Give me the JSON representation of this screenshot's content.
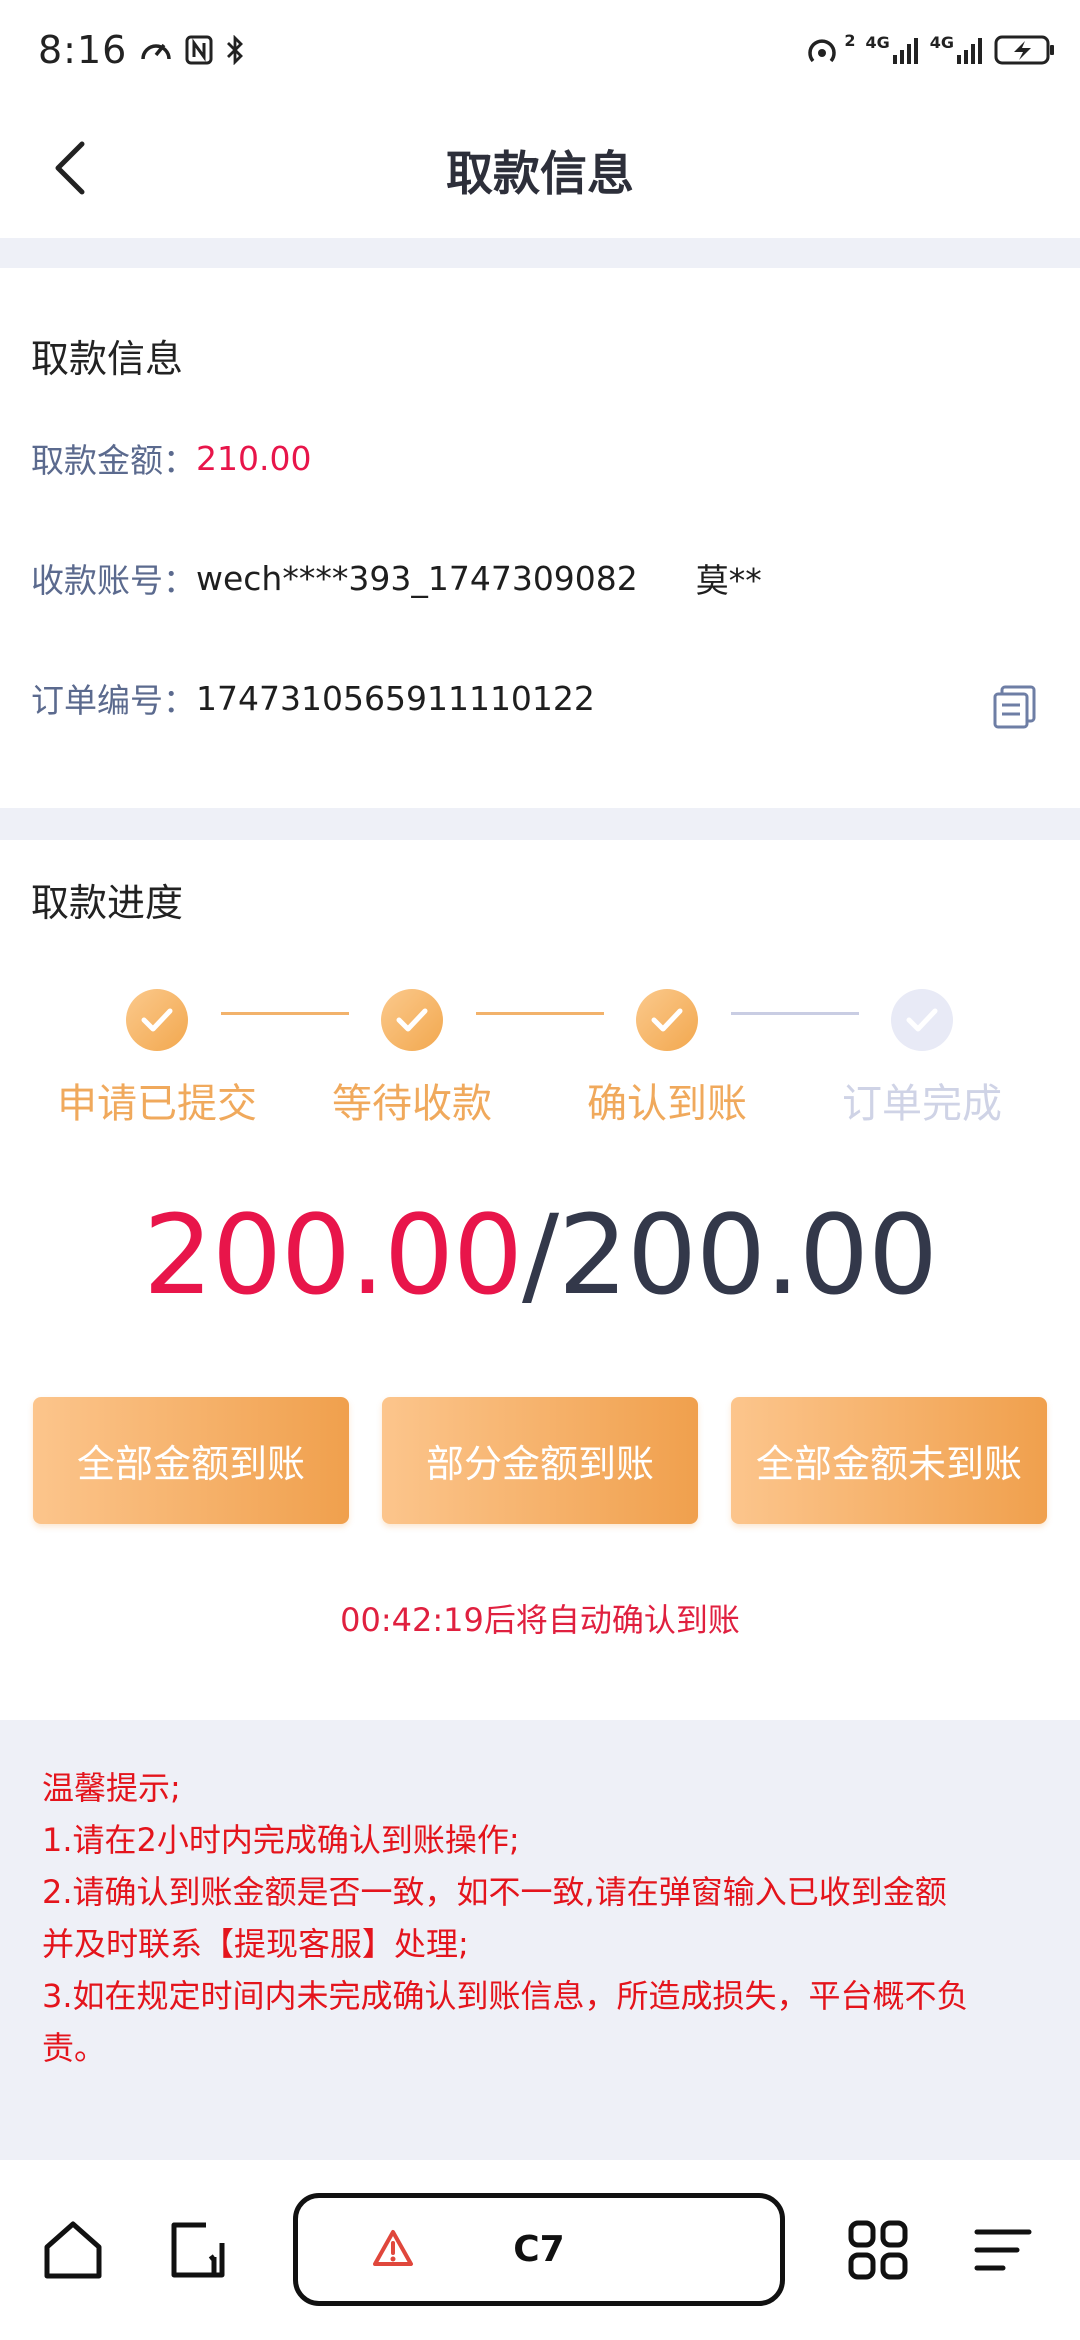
{
  "status_bar": {
    "time": "8:16",
    "sim_tag_1": "2",
    "net_1": "4G",
    "net_2": "4G"
  },
  "header": {
    "title": "取款信息"
  },
  "withdraw_info": {
    "section_title": "取款信息",
    "amount_label": "取款金额：",
    "amount_value": "210.00",
    "account_label": "收款账号：",
    "account_value": "wech****393_1747309082",
    "payee_name": "莫**",
    "order_label": "订单编号：",
    "order_value": "1747310565911110122"
  },
  "progress": {
    "section_title": "取款进度",
    "steps": [
      {
        "label": "申请已提交",
        "done": true
      },
      {
        "label": "等待收款",
        "done": true
      },
      {
        "label": "确认到账",
        "done": true
      },
      {
        "label": "订单完成",
        "done": false
      }
    ],
    "received": "200.00",
    "separator": "/",
    "total": "200.00",
    "buttons": {
      "all_received": "全部金额到账",
      "partial_received": "部分金额到账",
      "none_received": "全部金额未到账"
    },
    "countdown": "00:42:19后将自动确认到账"
  },
  "notice": {
    "title": "温馨提示;",
    "line1": "1.请在2小时内完成确认到账操作;",
    "line2a": "2.请确认到账金额是否一致，如不一致,请在弹窗输入已收到金额",
    "line2b": "并及时联系【提现客服】处理;",
    "line3a": "3.如在规定时间内未完成确认到账信息，所造成损失，平台概不负",
    "line3b": "责。"
  },
  "browser_bar": {
    "url_text": "C7"
  },
  "colors": {
    "accent_red": "#e8154a",
    "step_orange": "#f2a84f",
    "notice_red": "#e4141c",
    "label_blue_gray": "#5b6a8e"
  }
}
